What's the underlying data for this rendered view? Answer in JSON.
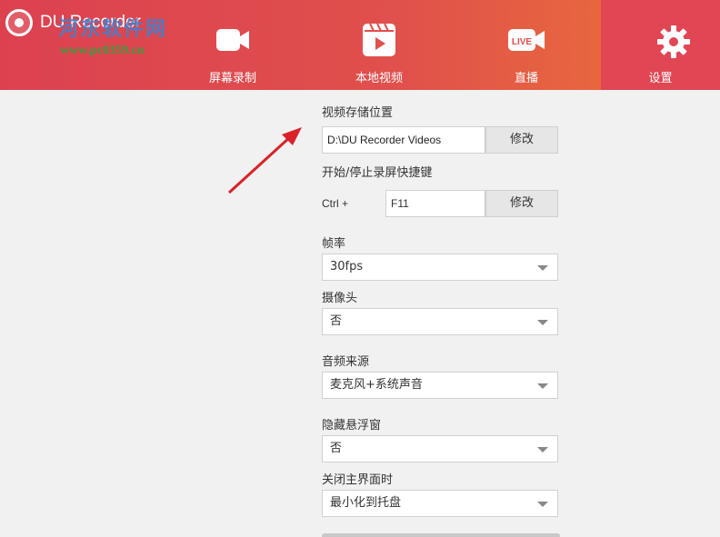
{
  "header": {
    "brand_title": "DU Recorder",
    "watermark_text": "河东软件网",
    "watermark_url": "www.pc0359.cn",
    "tabs": [
      {
        "label": "屏幕录制",
        "icon": "video-camera-icon"
      },
      {
        "label": "本地视频",
        "icon": "video-file-icon"
      },
      {
        "label": "直播",
        "icon": "live-camera-icon",
        "icon_text": "LIVE"
      },
      {
        "label": "设置",
        "icon": "gear-icon"
      }
    ],
    "active_tab": "设置"
  },
  "settings": {
    "storage": {
      "label": "视频存储位置",
      "value": "D:\\DU Recorder Videos",
      "button": "修改"
    },
    "hotkey": {
      "label": "开始/停止录屏快捷键",
      "modifier": "Ctrl  +",
      "key": "F11",
      "button": "修改"
    },
    "framerate": {
      "label": "帧率",
      "selected": "30fps"
    },
    "camera": {
      "label": "摄像头",
      "selected": "否"
    },
    "audio_source": {
      "label": "音频来源",
      "selected": "麦克风+系统声音"
    },
    "hide_float": {
      "label": "隐藏悬浮窗",
      "selected": "否"
    },
    "on_close": {
      "label": "关闭主界面时",
      "selected": "最小化到托盘"
    }
  },
  "colors": {
    "header_start": "#dc4150",
    "header_accent": "#e7683e",
    "arrow": "#d9222a"
  }
}
